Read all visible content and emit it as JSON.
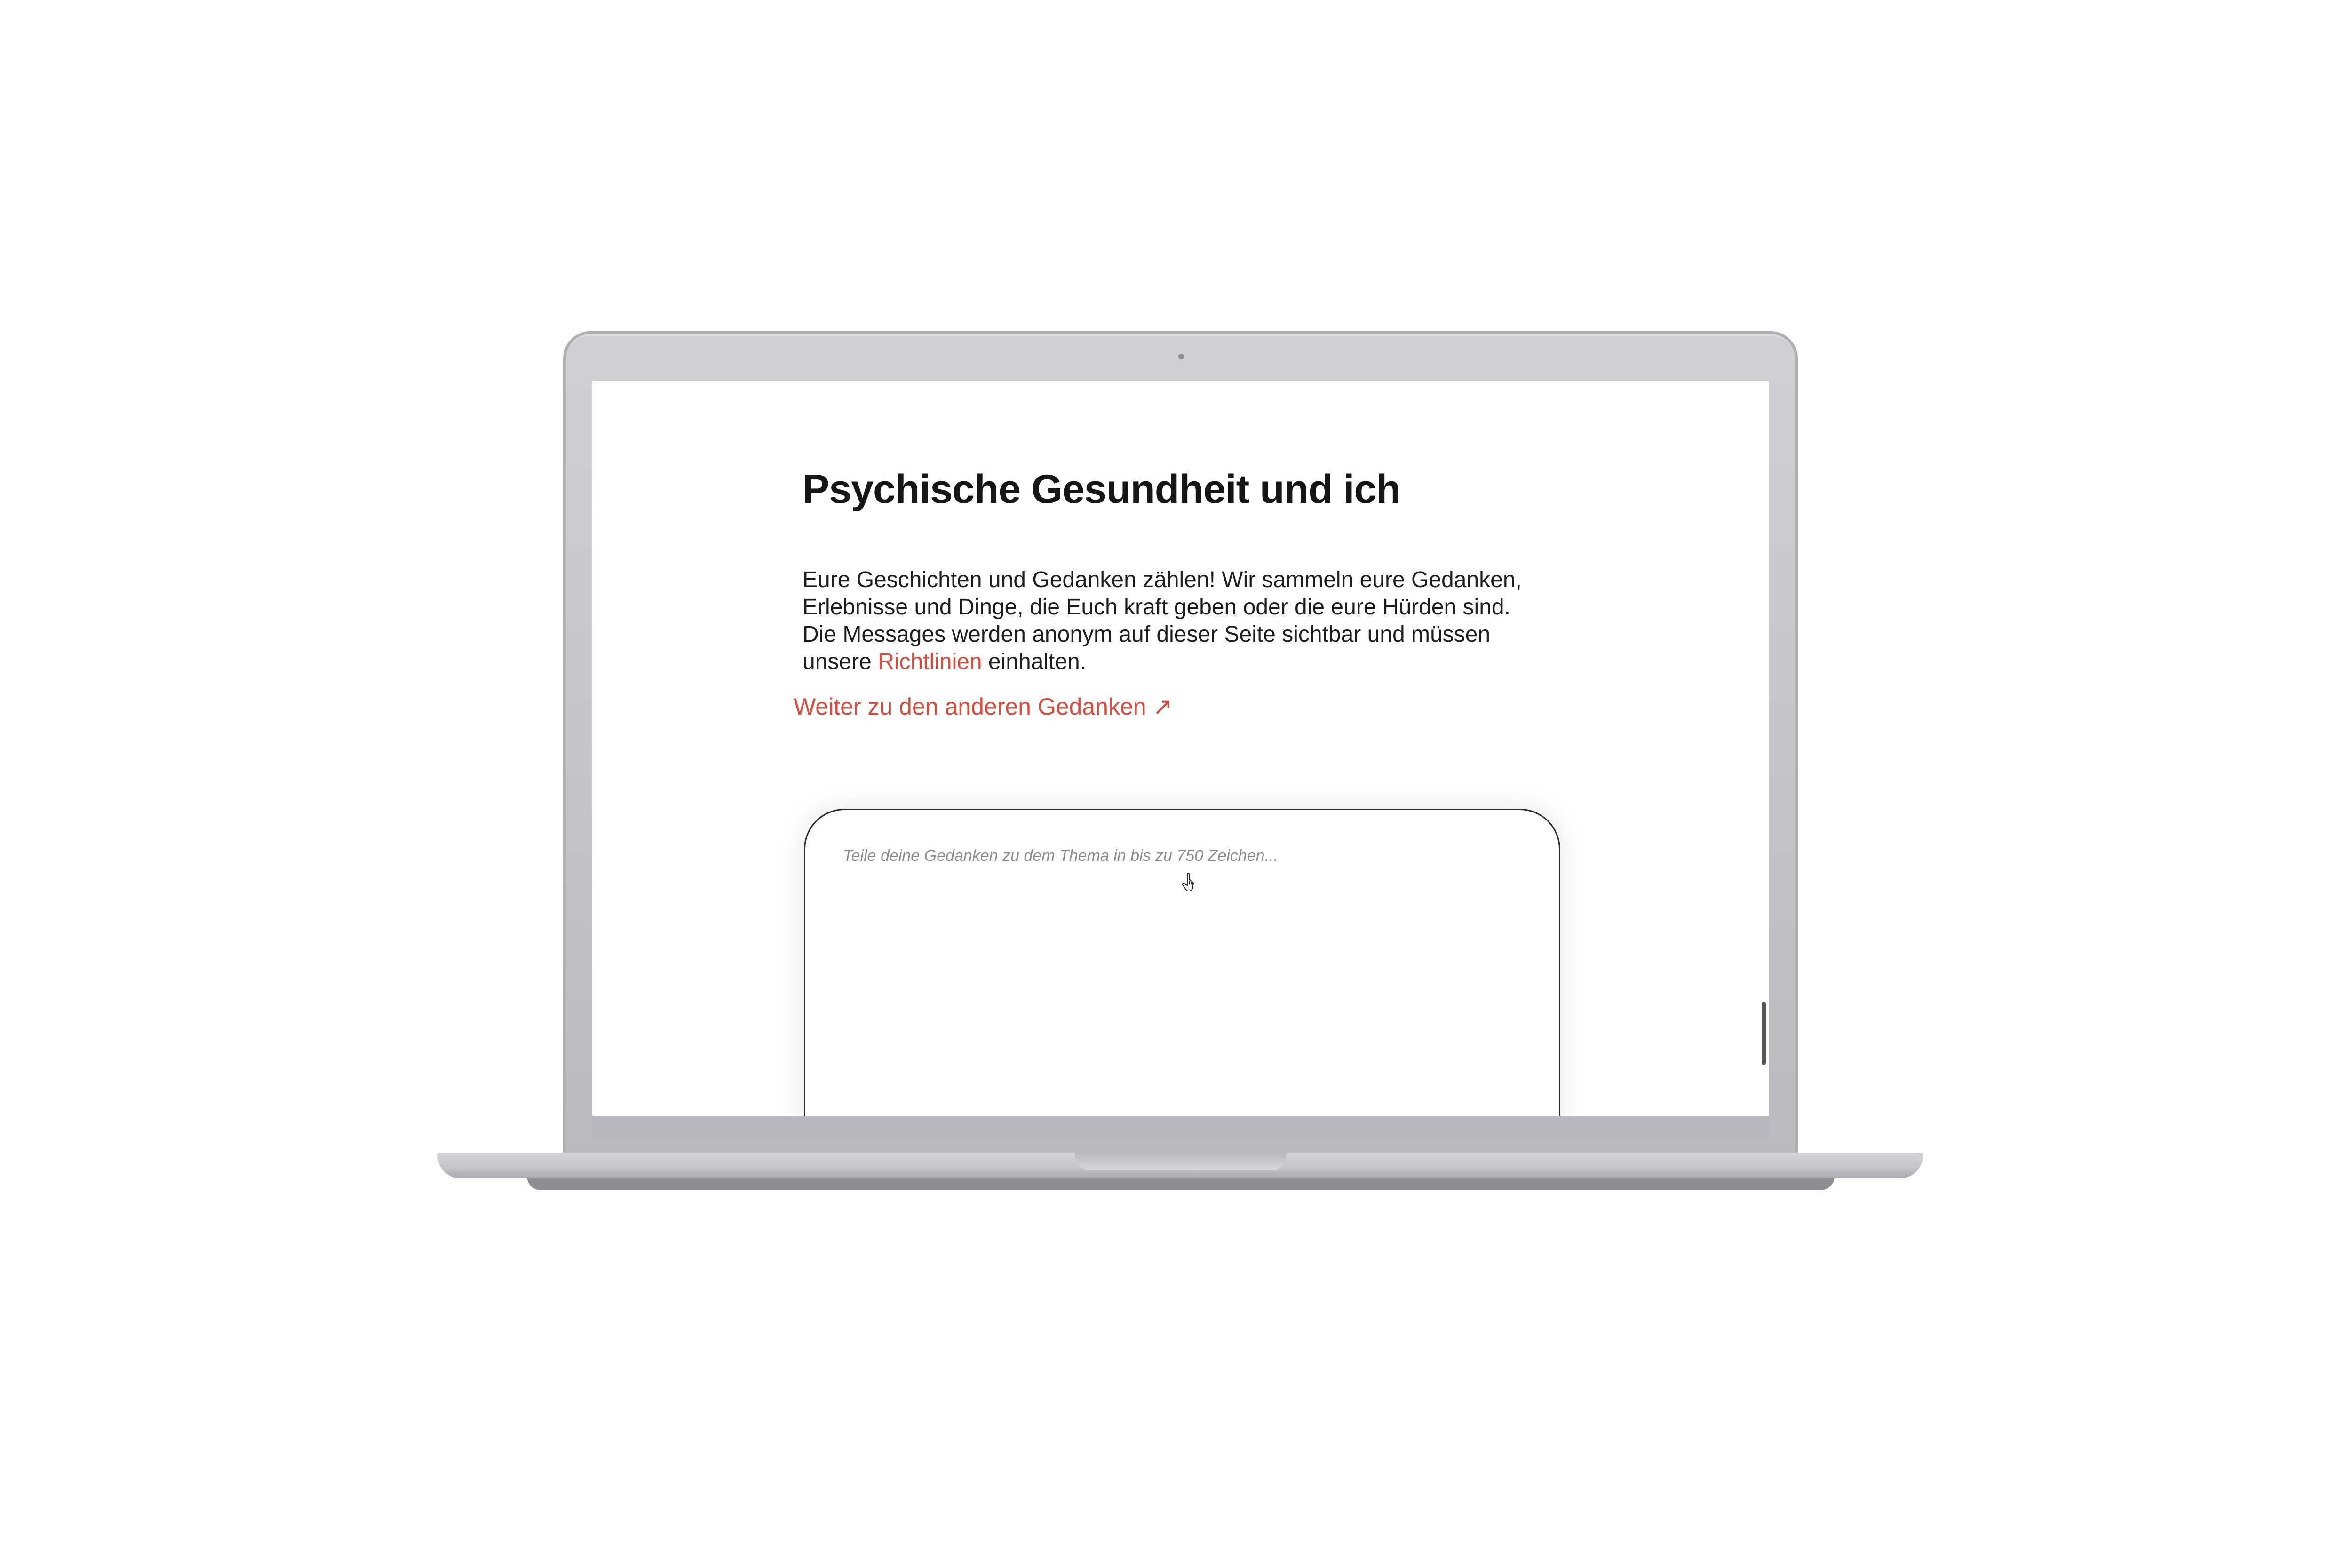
{
  "page": {
    "title": "Psychische Gesundheit und ich",
    "intro_lines": [
      "Eure Geschichten und Gedanken zählen! Wir sammeln eure Gedanken,",
      "Erlebnisse und Dinge, die Euch kraft geben oder die eure Hürden sind.",
      "Die Messages werden anonym auf dieser Seite sichtbar und müssen"
    ],
    "intro_last_prefix": "unsere ",
    "guidelines_link": "Richtlinien",
    "intro_last_suffix": " einhalten.",
    "more_link": "Weiter zu den anderen Gedanken",
    "more_link_arrow": "↗",
    "textbox_placeholder": "Teile deine Gedanken zu dem Thema in bis zu 750 Zeichen..."
  },
  "colors": {
    "accent": "#d64b3c",
    "text": "#161616",
    "laptop_shell": "#c2c3c8"
  },
  "icons": {
    "cursor": "hand-pointer-icon",
    "link_arrow": "arrow-up-right-icon"
  }
}
